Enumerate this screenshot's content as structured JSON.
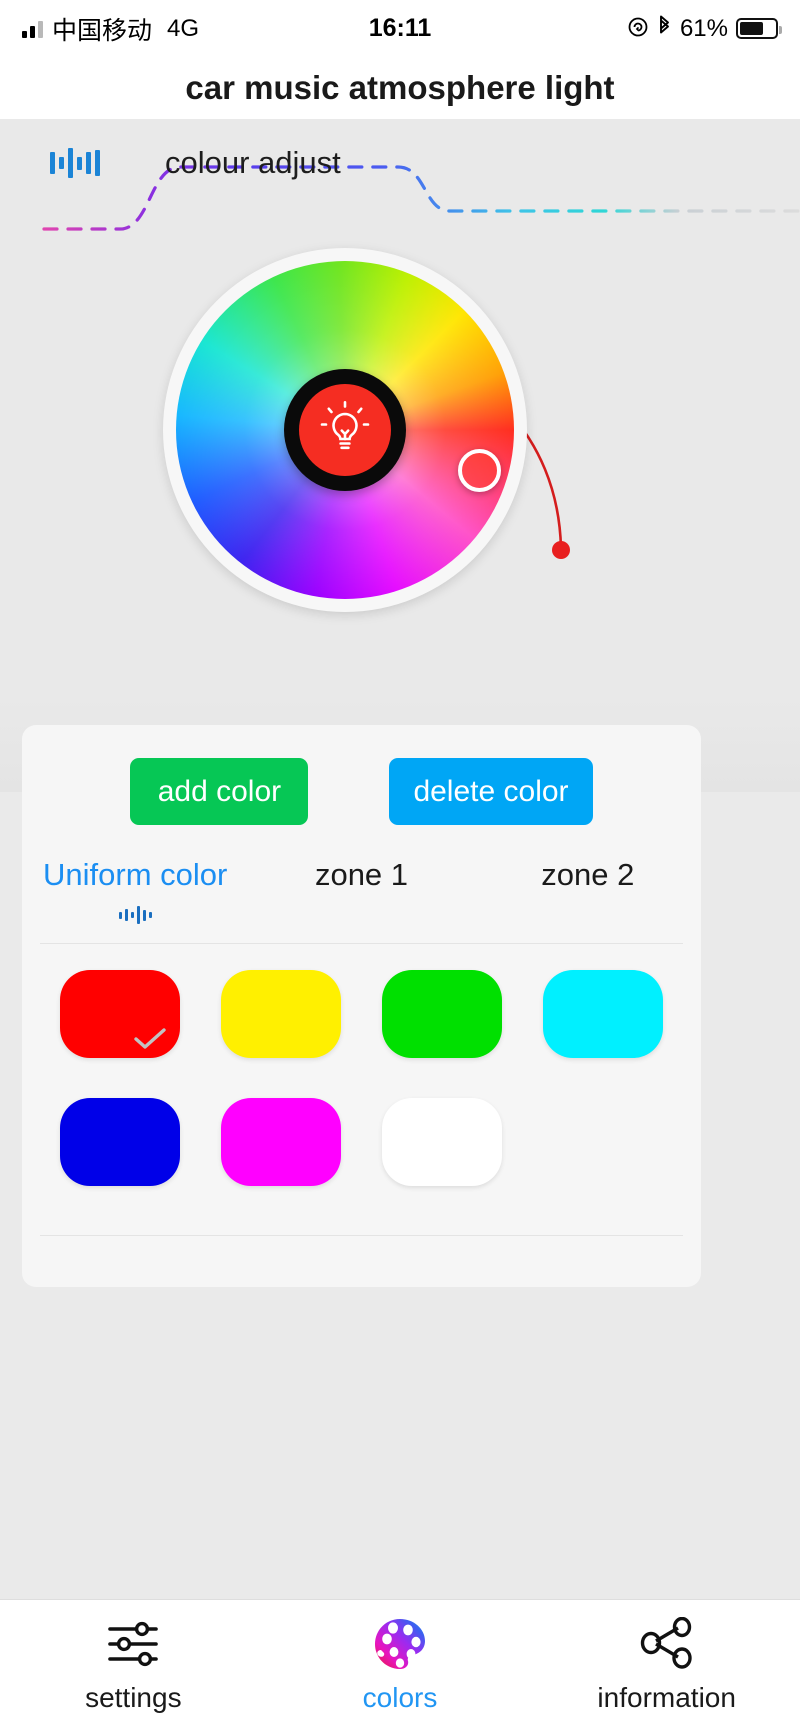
{
  "status_bar": {
    "carrier": "中国移动",
    "network": "4G",
    "time": "16:11",
    "battery_percent": "61%",
    "lock_rotation_icon": "rotation-lock-icon",
    "bluetooth_icon": "bluetooth-icon",
    "signal_icon": "signal-bars-icon",
    "battery_icon": "battery-icon"
  },
  "header": {
    "title": "car music atmosphere light"
  },
  "wheel_panel": {
    "tab_label": "colour adjust",
    "tab_eq_icon": "equalizer-icon",
    "center_icon": "lightbulb-icon",
    "center_ring_color": "#0a0a0a",
    "center_fill_color": "#f52d22",
    "thumb_icon": "color-picker-thumb",
    "arc_color": "#d41d1d",
    "swoosh_colors": [
      "#d63fd6",
      "#6633ee",
      "#2bb7e0",
      "#cfcfcf"
    ]
  },
  "card": {
    "buttons": {
      "add_label": "add color",
      "add_color": "#06c755",
      "delete_label": "delete color",
      "delete_color": "#00a6f5"
    },
    "zones": [
      {
        "label": "Uniform color",
        "active": true,
        "indicator_icon": "equalizer-icon"
      },
      {
        "label": "zone 1",
        "active": false
      },
      {
        "label": "zone 2",
        "active": false
      }
    ],
    "swatches": [
      {
        "name": "red",
        "color": "#ff0000",
        "selected": true
      },
      {
        "name": "yellow",
        "color": "#fff000",
        "selected": false
      },
      {
        "name": "green",
        "color": "#00e000",
        "selected": false
      },
      {
        "name": "cyan",
        "color": "#00f0ff",
        "selected": false
      },
      {
        "name": "blue",
        "color": "#0000e8",
        "selected": false
      },
      {
        "name": "magenta",
        "color": "#ff00ff",
        "selected": false
      },
      {
        "name": "white",
        "color": "#ffffff",
        "selected": false
      }
    ],
    "selected_check_color": "#c2c2c2"
  },
  "nav": {
    "items": [
      {
        "label": "settings",
        "icon": "sliders-icon",
        "active": false
      },
      {
        "label": "colors",
        "icon": "palette-icon",
        "active": true
      },
      {
        "label": "information",
        "icon": "share-nodes-icon",
        "active": false
      }
    ],
    "active_color": "#2196f3"
  }
}
